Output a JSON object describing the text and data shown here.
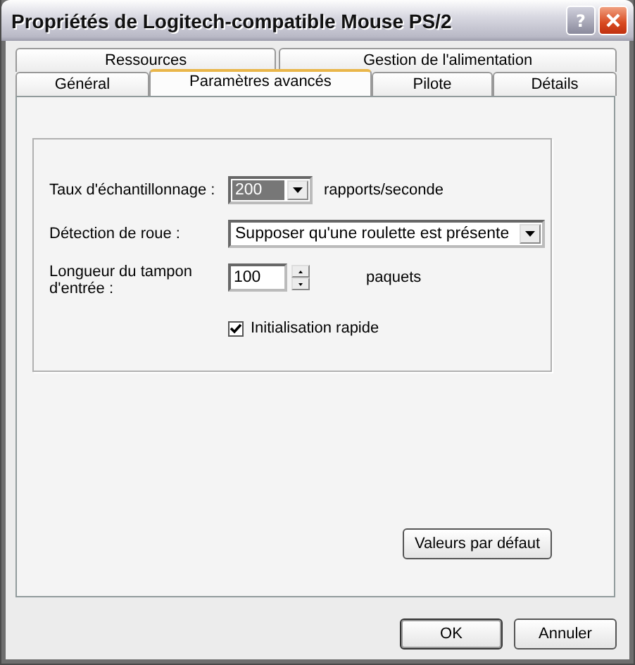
{
  "window": {
    "title": "Propriétés de Logitech-compatible Mouse PS/2",
    "help_button": "?"
  },
  "tab_rows": [
    [
      {
        "label": "Ressources",
        "selected": false
      },
      {
        "label": "Gestion de l'alimentation",
        "selected": false
      }
    ],
    [
      {
        "label": "Général",
        "selected": false
      },
      {
        "label": "Paramètres avancés",
        "selected": true
      },
      {
        "label": "Pilote",
        "selected": false
      },
      {
        "label": "Détails",
        "selected": false
      }
    ]
  ],
  "settings": [
    {
      "kind": "dropdown",
      "label": "Taux d'échantillonnage :",
      "value": "200",
      "suffix": "rapports/seconde",
      "focused": true
    },
    {
      "kind": "dropdown",
      "label": "Détection de roue :",
      "value": "Supposer qu'une roulette est présente",
      "focused": false
    },
    {
      "kind": "spinner",
      "label": "Longueur du tampon d'entrée :",
      "value": "100",
      "suffix": "paquets"
    },
    {
      "kind": "checkbox",
      "label": "Initialisation rapide",
      "checked": true
    }
  ],
  "defaults_button": "Valeurs par défaut",
  "buttons": [
    "OK",
    "Annuler"
  ]
}
